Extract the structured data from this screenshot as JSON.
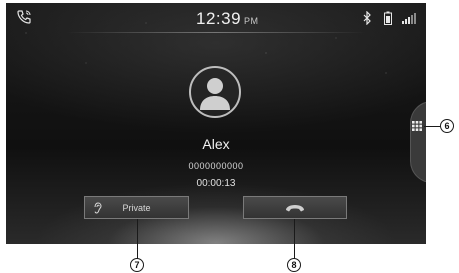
{
  "status_bar": {
    "time": "12:39",
    "ampm": "PM",
    "icons": [
      "phone-call-icon",
      "bluetooth-icon",
      "battery-icon",
      "signal-icon"
    ]
  },
  "call": {
    "caller_name": "Alex",
    "caller_number": "0000000000",
    "duration": "00:00:13"
  },
  "buttons": {
    "private_label": "Private",
    "end_call_icon": "hang-up-icon"
  },
  "side_tab": {
    "icon": "keypad-icon"
  },
  "callouts": {
    "keypad": "6",
    "private": "7",
    "end_call": "8"
  },
  "colors": {
    "screen_background": "#141414",
    "button_background": "#3c3c3c",
    "text": "#f0f0f0"
  }
}
